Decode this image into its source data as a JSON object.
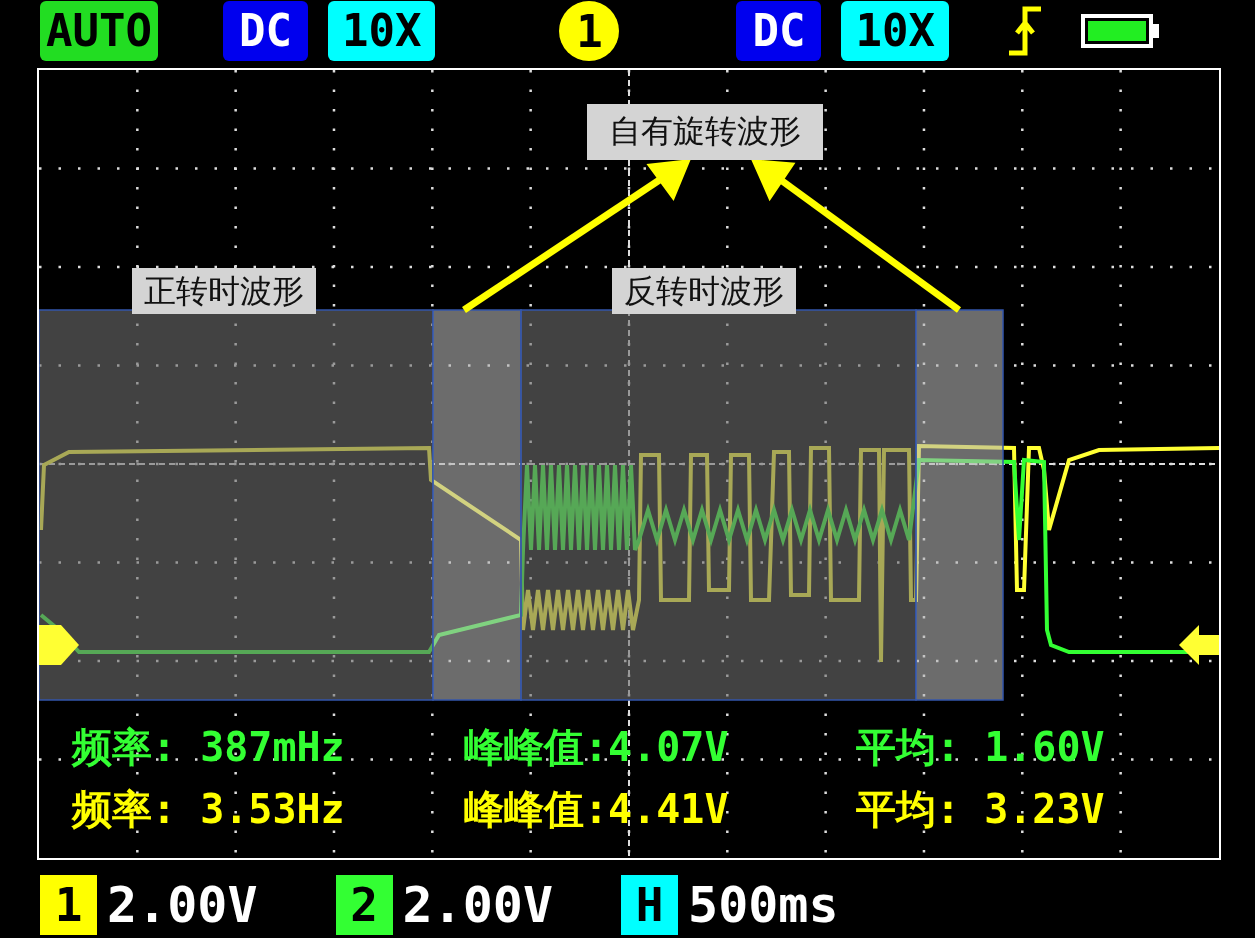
{
  "top_bar": {
    "mode": "AUTO",
    "channels": [
      {
        "coupling": "DC",
        "probe": "10X"
      },
      {
        "coupling": "DC",
        "probe": "10X"
      }
    ],
    "selected_channel": "1"
  },
  "screen": {
    "callout": "自有旋转波形",
    "section_labels": [
      "正转时波形",
      "反转时波形"
    ],
    "measurements": [
      {
        "color": "#33ff33",
        "items": [
          "频率: 387mHz",
          "峰峰值:4.07V",
          "平均: 1.60V"
        ]
      },
      {
        "color": "#ffff00",
        "items": [
          "频率: 3.53Hz",
          "峰峰值:4.41V",
          "平均: 3.23V"
        ]
      }
    ]
  },
  "bottom_bar": [
    {
      "badge": "1",
      "value": "2.00V",
      "color": "#ffff00"
    },
    {
      "badge": "2",
      "value": "2.00V",
      "color": "#33ff33"
    },
    {
      "badge": "H",
      "value": "500ms",
      "color": "#00ffff"
    }
  ]
}
